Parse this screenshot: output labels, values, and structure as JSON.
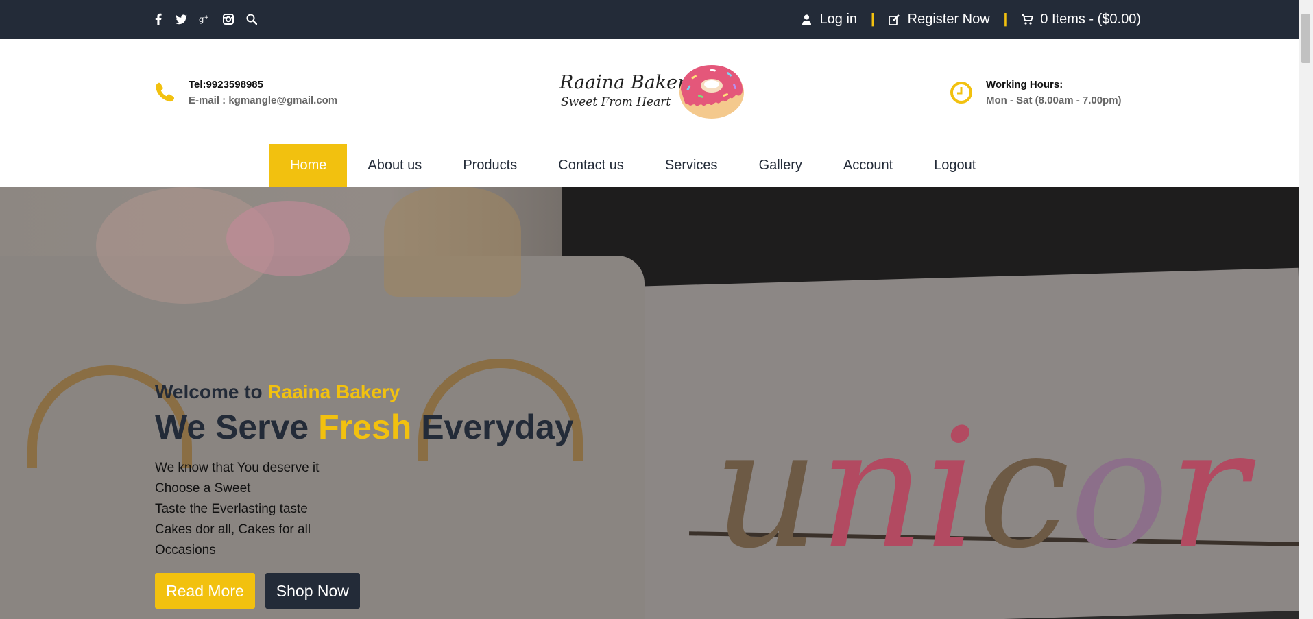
{
  "topbar": {
    "social_icons": [
      "facebook-icon",
      "twitter-icon",
      "google-plus-icon",
      "instagram-icon",
      "search-icon"
    ],
    "login": "Log in",
    "register": "Register Now",
    "cart": "0 Items - ($0.00)",
    "separator": "|"
  },
  "header": {
    "tel": "Tel:9923598985",
    "email": "E-mail : kgmangle@gmail.com",
    "logo_line1": "Raaina Bakery",
    "logo_line2": "Sweet From Heart",
    "hours_title": "Working Hours:",
    "hours_value": "Mon - Sat (8.00am - 7.00pm)"
  },
  "nav": {
    "items": [
      "Home",
      "About us",
      "Products",
      "Contact us",
      "Services",
      "Gallery",
      "Account",
      "Logout"
    ],
    "active": "Home"
  },
  "hero": {
    "welcome_prefix": "Welcome to",
    "welcome_brand": "Raaina Bakery",
    "headline_part1": "We Serve",
    "headline_accent": "Fresh",
    "headline_part2": "Everyday",
    "lines": [
      "We know that You deserve it",
      "Choose a Sweet",
      "Taste the Everlasting taste",
      "Cakes dor all, Cakes for all",
      "Occasions"
    ],
    "read_more": "Read More",
    "shop_now": "Shop Now"
  },
  "colors": {
    "accent": "#f2c10f",
    "dark": "#232b38"
  }
}
